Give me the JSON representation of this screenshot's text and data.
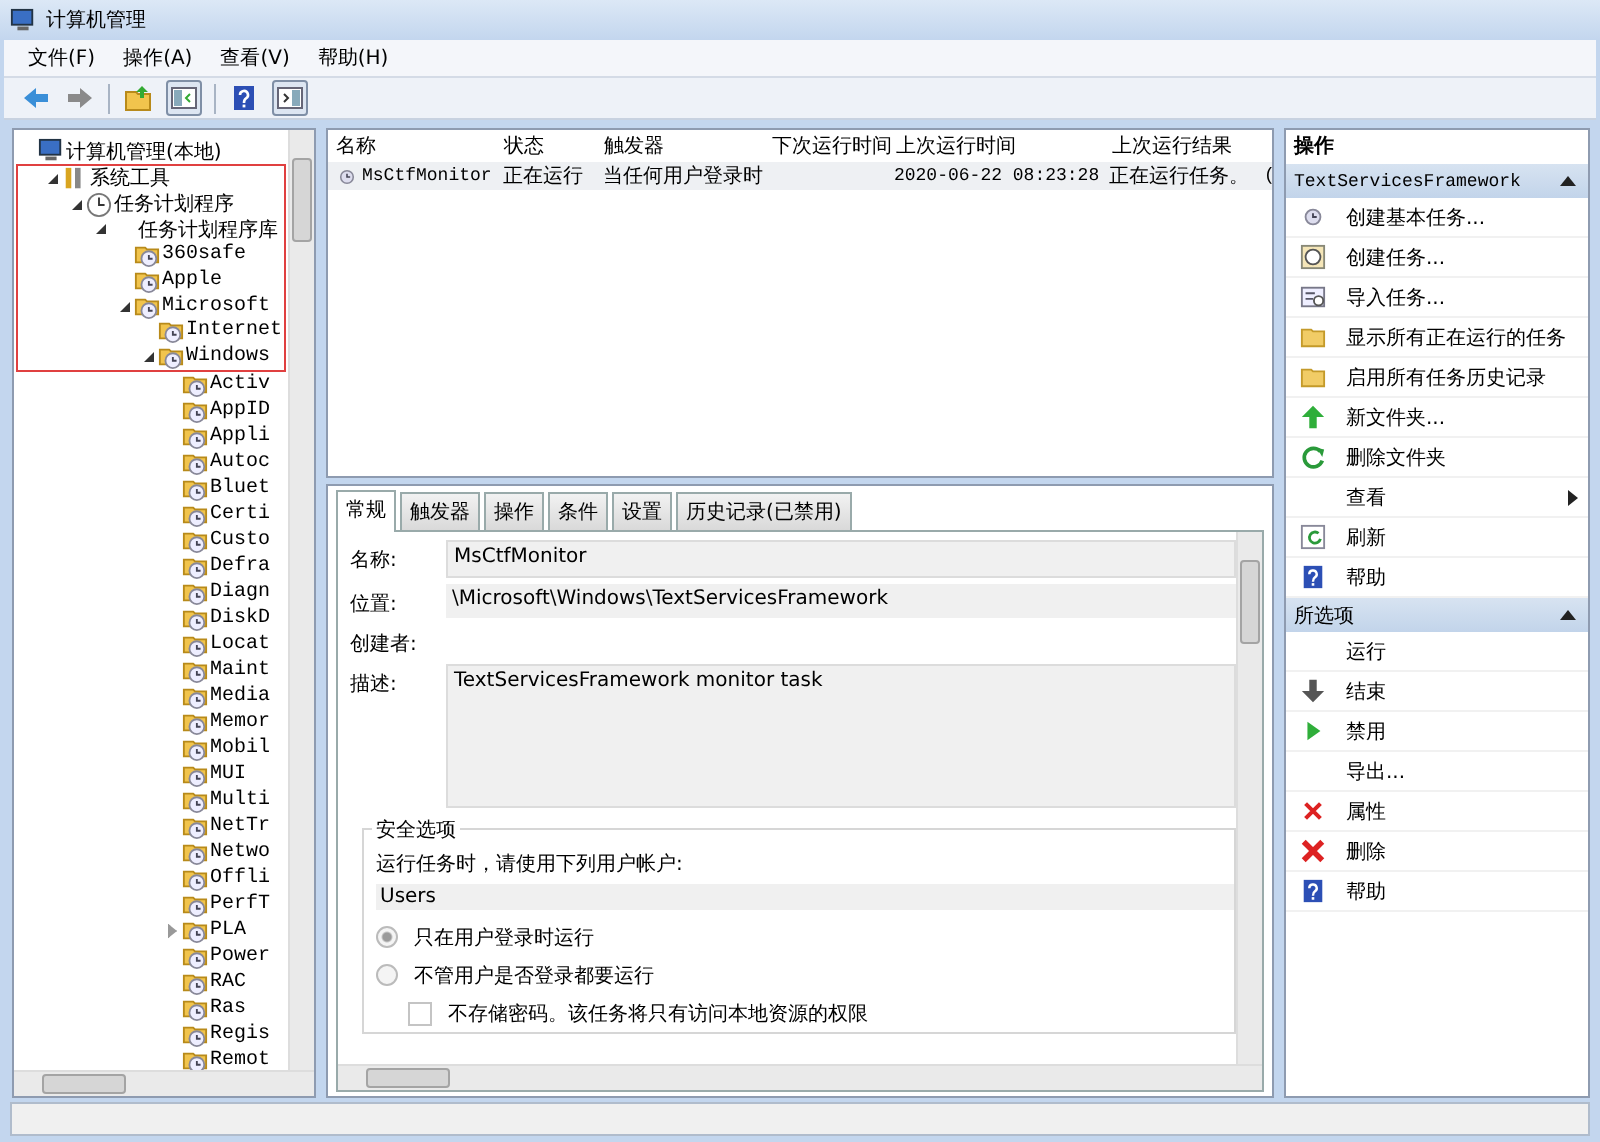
{
  "window": {
    "title": "计算机管理"
  },
  "menu": [
    "文件(F)",
    "操作(A)",
    "查看(V)",
    "帮助(H)"
  ],
  "tree": {
    "nodes": [
      {
        "label": "计算机管理(本地)",
        "children": [
          {
            "label": "系统工具",
            "expanded": true,
            "highlighted": true,
            "children": [
              {
                "label": "任务计划程序",
                "expanded": true,
                "highlighted": true,
                "children": [
                  {
                    "label": "任务计划程序库",
                    "expanded": true,
                    "highlighted": true,
                    "children": [
                      {
                        "label": "360safe",
                        "highlighted": true
                      },
                      {
                        "label": "Apple",
                        "highlighted": true
                      },
                      {
                        "label": "Microsoft",
                        "expanded": true,
                        "highlighted": true,
                        "children": [
                          {
                            "label": "Internet",
                            "highlighted": true
                          },
                          {
                            "label": "Windows",
                            "expanded": true,
                            "highlighted": true,
                            "children": [
                              {
                                "label": "Activ"
                              },
                              {
                                "label": "AppID"
                              },
                              {
                                "label": "Appli"
                              },
                              {
                                "label": "Autoc"
                              },
                              {
                                "label": "Bluet"
                              },
                              {
                                "label": "Certi"
                              },
                              {
                                "label": "Custo"
                              },
                              {
                                "label": "Defra"
                              },
                              {
                                "label": "Diagn"
                              },
                              {
                                "label": "DiskD"
                              },
                              {
                                "label": "Locat"
                              },
                              {
                                "label": "Maint"
                              },
                              {
                                "label": "Media"
                              },
                              {
                                "label": "Memor"
                              },
                              {
                                "label": "Mobil"
                              },
                              {
                                "label": "MUI"
                              },
                              {
                                "label": "Multi"
                              },
                              {
                                "label": "NetTr"
                              },
                              {
                                "label": "Netwo"
                              },
                              {
                                "label": "Offli"
                              },
                              {
                                "label": "PerfT"
                              },
                              {
                                "label": "PLA",
                                "expanded": false
                              },
                              {
                                "label": "Power"
                              },
                              {
                                "label": "RAC"
                              },
                              {
                                "label": "Ras"
                              },
                              {
                                "label": "Regis"
                              },
                              {
                                "label": "Remot"
                              }
                            ]
                          }
                        ]
                      }
                    ]
                  }
                ]
              }
            ]
          }
        ]
      }
    ]
  },
  "task_list": {
    "columns": [
      "名称",
      "状态",
      "触发器",
      "下次运行时间",
      "上次运行时间",
      "上次运行结果"
    ],
    "rows": [
      {
        "name": "MsCtfMonitor",
        "status": "正在运行",
        "trigger": "当任何用户登录时",
        "last_run_time": "2020-06-22 08:23:28",
        "last_run_result": "正在运行任务。",
        "column_7": "("
      }
    ]
  },
  "details": {
    "tabs": [
      {
        "label": "常规",
        "selected": true
      },
      {
        "label": "触发器",
        "selected": false
      },
      {
        "label": "操作",
        "selected": false
      },
      {
        "label": "条件",
        "selected": false
      },
      {
        "label": "设置",
        "selected": false
      },
      {
        "label": "历史记录(已禁用)",
        "selected": false
      }
    ],
    "fields": [
      {
        "kind": "box",
        "label": "名称:",
        "value": "MsCtfMonitor"
      },
      {
        "kind": "band",
        "label": "位置:",
        "value": "\\Microsoft\\Windows\\TextServicesFramework"
      },
      {
        "kind": "band",
        "label": "创建者:"
      },
      {
        "kind": "area",
        "label": "描述:",
        "value": "TextServicesFramework monitor task"
      }
    ],
    "security": {
      "title": "安全选项",
      "prompt": "运行任务时，请使用下列用户帐户:",
      "account": "Users",
      "options": [
        {
          "kind": "radio",
          "label": "只在用户登录时运行",
          "selected": true,
          "disabled": true
        },
        {
          "kind": "radio",
          "label": "不管用户是否登录都要运行",
          "selected": false,
          "disabled": true
        },
        {
          "kind": "checkbox",
          "label": "不存储密码。该任务将只有访问本地资源的权限",
          "checked": false,
          "disabled": true
        }
      ]
    }
  },
  "actions": {
    "title": "操作",
    "sections": [
      {
        "title": "TextServicesFramework",
        "expanded": true,
        "items": [
          {
            "label": "创建基本任务...",
            "submenu": false
          },
          {
            "label": "创建任务...",
            "submenu": false
          },
          {
            "label": "导入任务...",
            "submenu": false
          },
          {
            "label": "显示所有正在运行的任务",
            "submenu": false
          },
          {
            "label": "启用所有任务历史记录",
            "submenu": false
          },
          {
            "label": "新文件夹...",
            "submenu": false
          },
          {
            "label": "删除文件夹",
            "submenu": false
          },
          {
            "label": "查看",
            "submenu": true
          },
          {
            "label": "刷新",
            "submenu": false
          },
          {
            "label": "帮助",
            "submenu": false
          }
        ]
      },
      {
        "title": "所选项",
        "expanded": true,
        "items": [
          {
            "label": "运行",
            "submenu": false
          },
          {
            "label": "结束",
            "submenu": false
          },
          {
            "label": "禁用",
            "submenu": false
          },
          {
            "label": "导出...",
            "submenu": false
          },
          {
            "label": "属性",
            "submenu": false
          },
          {
            "label": "删除",
            "submenu": false
          },
          {
            "label": "帮助",
            "submenu": false
          }
        ]
      }
    ]
  }
}
